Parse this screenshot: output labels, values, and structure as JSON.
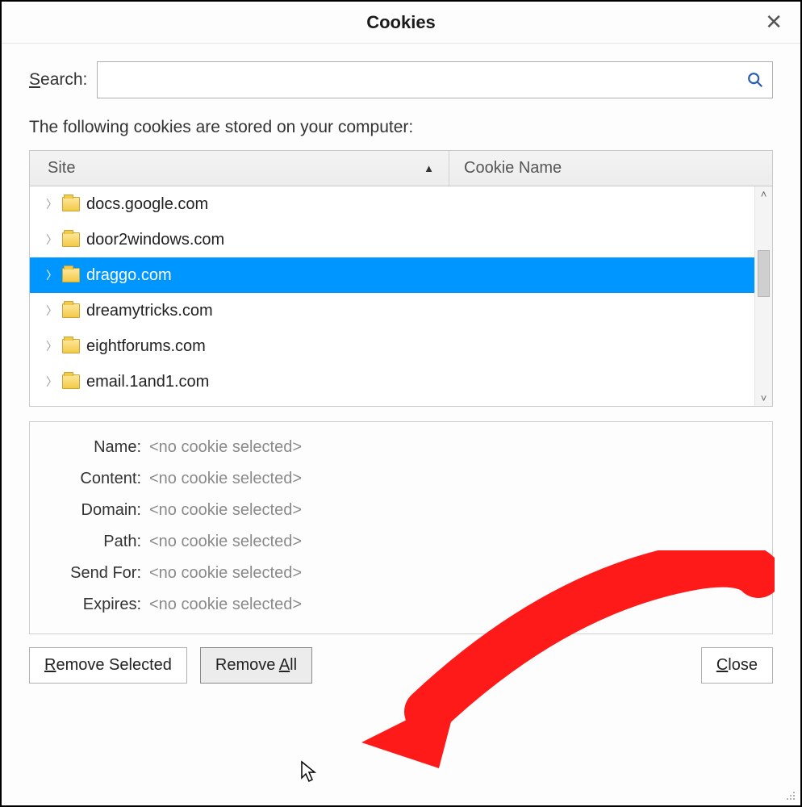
{
  "title": "Cookies",
  "search": {
    "label_pre": "S",
    "label_post": "earch:",
    "value": "",
    "placeholder": ""
  },
  "intro": "The following cookies are stored on your computer:",
  "columns": {
    "site": "Site",
    "cookie_name": "Cookie Name"
  },
  "sites": [
    {
      "name": "docs.google.com",
      "selected": false
    },
    {
      "name": "door2windows.com",
      "selected": false
    },
    {
      "name": "draggo.com",
      "selected": true
    },
    {
      "name": "dreamytricks.com",
      "selected": false
    },
    {
      "name": "eightforums.com",
      "selected": false
    },
    {
      "name": "email.1and1.com",
      "selected": false
    }
  ],
  "details": {
    "placeholder": "<no cookie selected>",
    "fields": [
      {
        "label": "Name:"
      },
      {
        "label": "Content:"
      },
      {
        "label": "Domain:"
      },
      {
        "label": "Path:"
      },
      {
        "label": "Send For:"
      },
      {
        "label": "Expires:"
      }
    ]
  },
  "buttons": {
    "remove_selected_pre": "R",
    "remove_selected_post": "emove Selected",
    "remove_all_pre": "Remove ",
    "remove_all_ul": "A",
    "remove_all_post": "ll",
    "close_pre": "C",
    "close_post": "lose"
  },
  "colors": {
    "selection": "#0096ff",
    "annotation": "#ff0000"
  }
}
